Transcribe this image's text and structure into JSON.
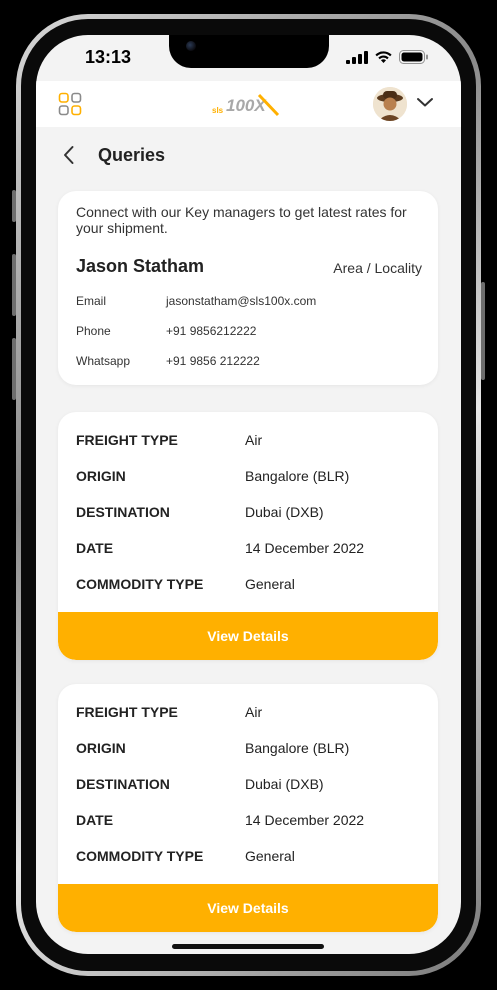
{
  "status_bar": {
    "time": "13:13"
  },
  "app_bar": {
    "logo_prefix": "sls",
    "logo_main": "100X",
    "brand_color": "#ffb000"
  },
  "page": {
    "title": "Queries"
  },
  "contact": {
    "intro": "Connect with our Key managers to get latest rates for your shipment.",
    "name": "Jason Statham",
    "area": "Area / Locality",
    "rows": [
      {
        "label": "Email",
        "value": "jasonstatham@sls100x.com"
      },
      {
        "label": "Phone",
        "value": "+91 9856212222"
      },
      {
        "label": "Whatsapp",
        "value": "+91 9856 212222"
      }
    ]
  },
  "queries": [
    {
      "rows": [
        {
          "label": "FREIGHT TYPE",
          "value": "Air"
        },
        {
          "label": "ORIGIN",
          "value": "Bangalore (BLR)"
        },
        {
          "label": "DESTINATION",
          "value": "Dubai (DXB)"
        },
        {
          "label": "DATE",
          "value": "14 December 2022"
        },
        {
          "label": "COMMODITY TYPE",
          "value": "General"
        }
      ],
      "button_label": "View Details"
    },
    {
      "rows": [
        {
          "label": "FREIGHT TYPE",
          "value": "Air"
        },
        {
          "label": "ORIGIN",
          "value": "Bangalore (BLR)"
        },
        {
          "label": "DESTINATION",
          "value": "Dubai (DXB)"
        },
        {
          "label": "DATE",
          "value": "14 December 2022"
        },
        {
          "label": "COMMODITY TYPE",
          "value": "General"
        }
      ],
      "button_label": "View Details"
    }
  ]
}
